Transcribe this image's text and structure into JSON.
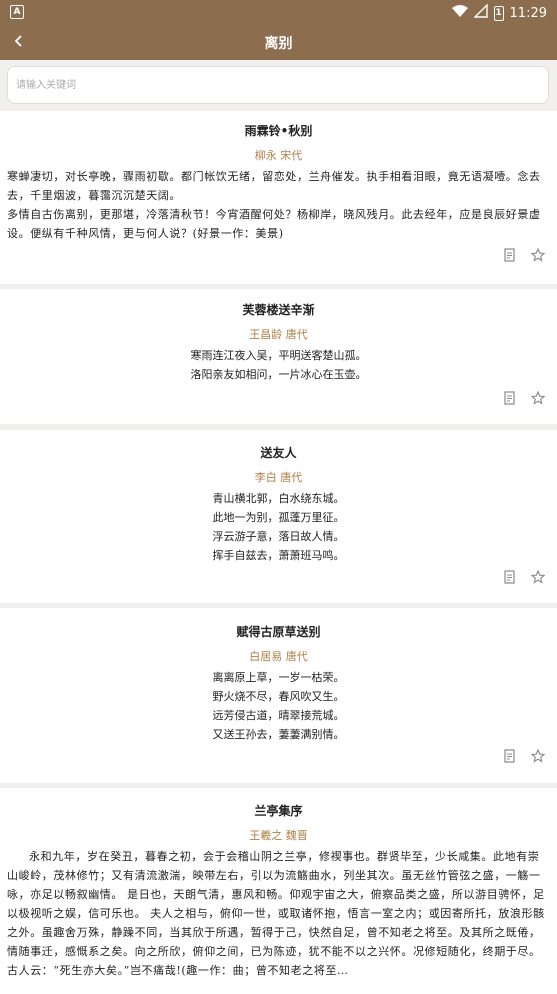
{
  "status_bar": {
    "app_badge": "A",
    "battery_level": "1",
    "time": "11:29"
  },
  "header": {
    "title": "离别"
  },
  "search": {
    "placeholder": "请输入关键词"
  },
  "poems": [
    {
      "title": "雨霖铃•秋别",
      "author": "柳永  宋代",
      "lines": [
        "寒蝉凄切，对长亭晚，骤雨初歇。都门帐饮无绪，留恋处，兰舟催发。执手相看泪眼，竟无语凝噎。念去去，千里烟波，暮霭沉沉楚天阔。",
        "多情自古伤离别，更那堪，冷落清秋节！今宵酒醒何处？杨柳岸，晓风残月。此去经年，应是良辰好景虚设。便纵有千种风情，更与何人说？(好景一作：美景)"
      ]
    },
    {
      "title": "芙蓉楼送辛渐",
      "author": "王昌龄  唐代",
      "lines": [
        "寒雨连江夜入吴，平明送客楚山孤。",
        "洛阳亲友如相问，一片冰心在玉壶。"
      ]
    },
    {
      "title": "送友人",
      "author": "李白  唐代",
      "lines": [
        "青山横北郭，白水绕东城。",
        "此地一为别，孤蓬万里征。",
        "浮云游子意，落日故人情。",
        "挥手自兹去，萧萧班马鸣。"
      ]
    },
    {
      "title": "赋得古原草送别",
      "author": "白居易  唐代",
      "lines": [
        "离离原上草，一岁一枯荣。",
        "野火烧不尽，春风吹又生。",
        "远芳侵古道，晴翠接荒城。",
        "又送王孙去，萋萋满别情。"
      ]
    },
    {
      "title": "兰亭集序",
      "author": "王羲之  魏晋",
      "lines": [
        "永和九年，岁在癸丑，暮春之初，会于会稽山阴之兰亭，修禊事也。群贤毕至，少长咸集。此地有崇山峻岭，茂林修竹；又有清流激湍，映带左右，引以为流觞曲水，列坐其次。虽无丝竹管弦之盛，一觞一咏，亦足以畅叙幽情。       是日也，天朗气清，惠风和畅。仰观宇宙之大，俯察品类之盛，所以游目骋怀，足以极视听之娱，信可乐也。     夫人之相与，俯仰一世，或取诸怀抱，悟言一室之内；或因寄所托，放浪形骸之外。虽趣舍万殊，静躁不同，当其欣于所遇，暂得于己，快然自足，曾不知老之将至。及其所之既倦，情随事迁，感慨系之矣。向之所欣，俯仰之间，已为陈迹，犹不能不以之兴怀。况修短随化，终期于尽。古人云：“死生亦大矣。”岂不痛哉!(趣一作：曲；曾不知老之将至…"
      ]
    }
  ]
}
